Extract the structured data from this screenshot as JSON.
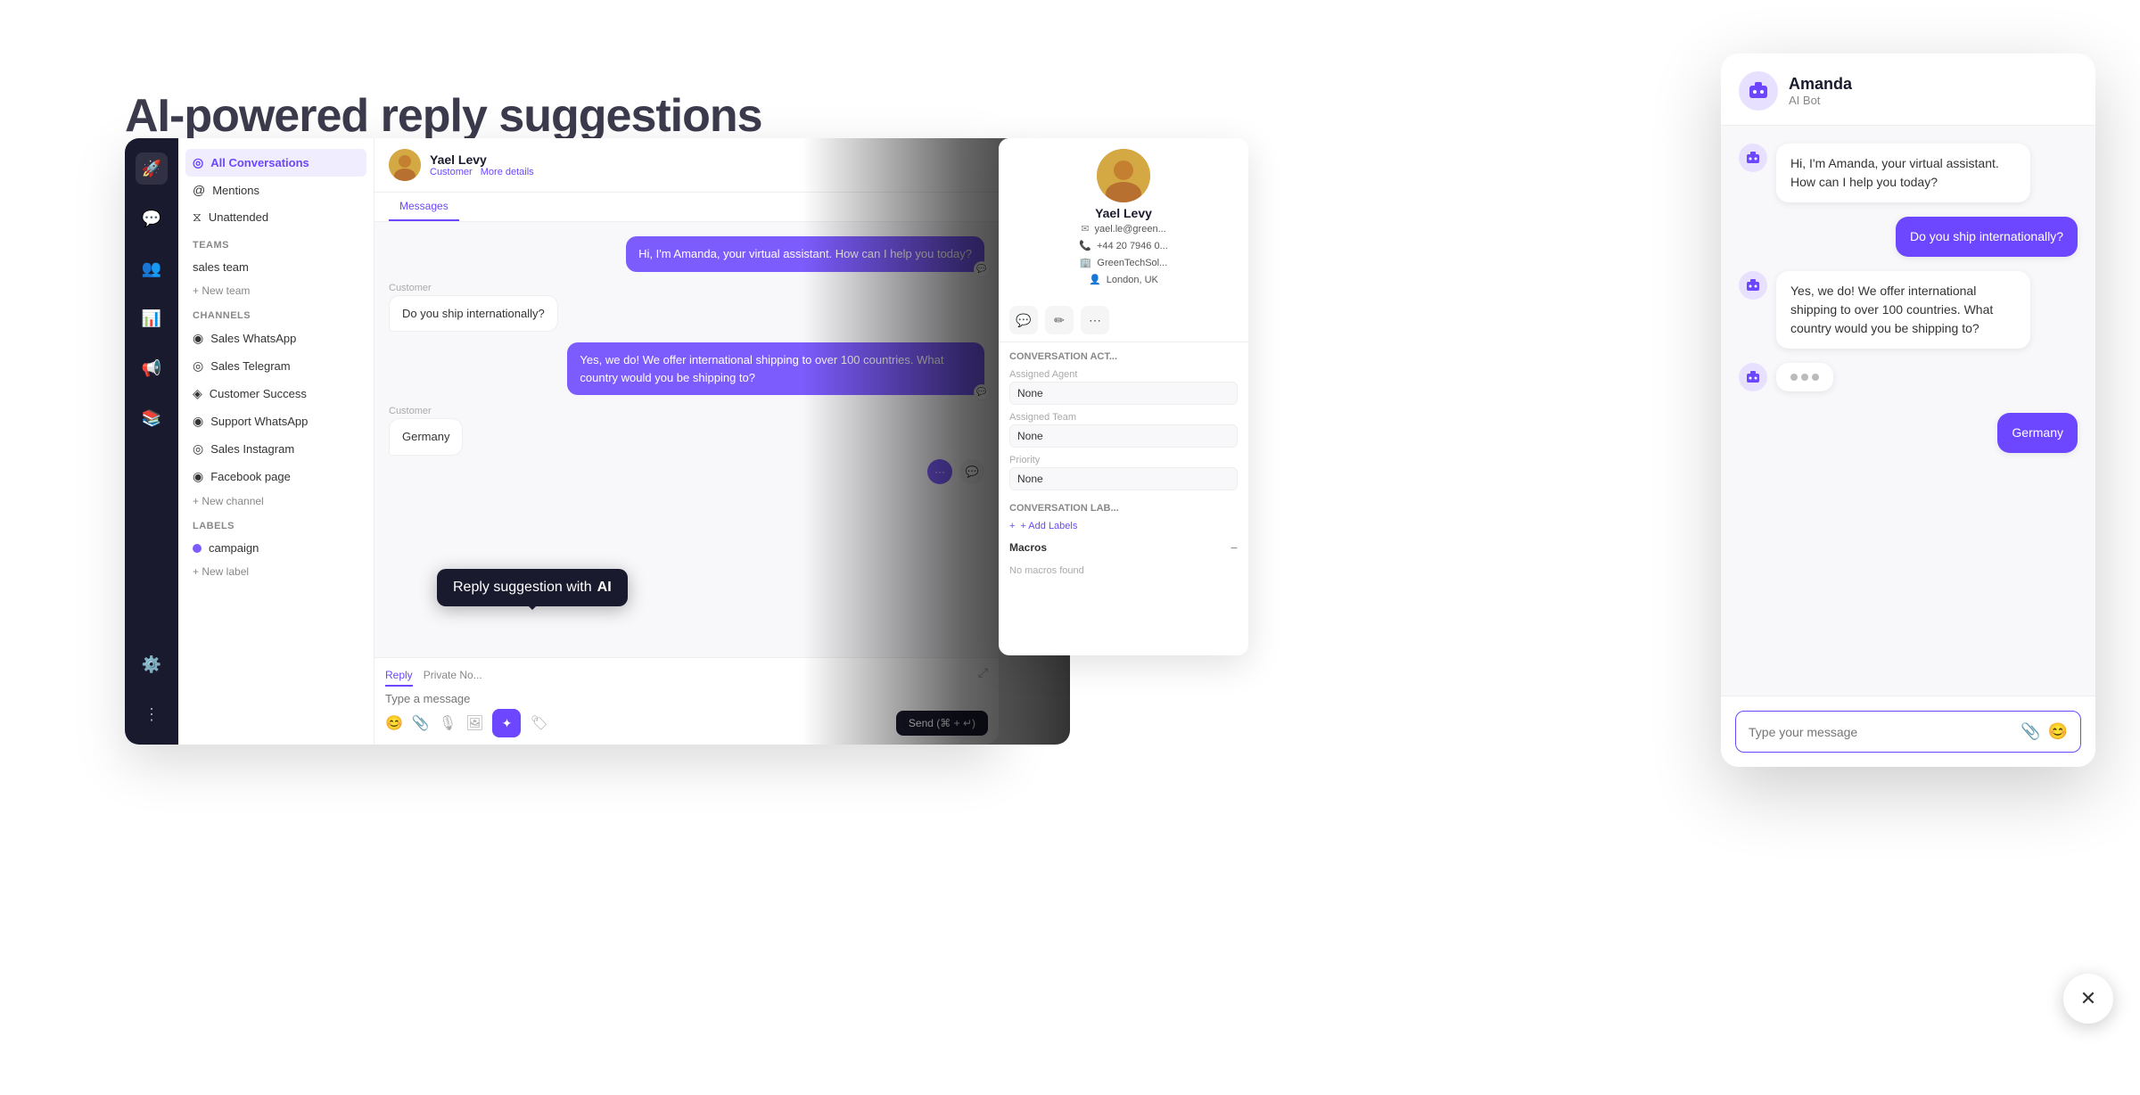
{
  "page": {
    "title": "AI-powered reply suggestions",
    "bg_text": "AI-powered reply suggestions"
  },
  "sidebar": {
    "all_conversations": "All Conversations",
    "mentions": "Mentions",
    "unattended": "Unattended",
    "teams_section": "Teams",
    "sales_team": "sales team",
    "new_team": "+ New team",
    "channels_section": "Channels",
    "channels": [
      "Sales WhatsApp",
      "Sales Telegram",
      "Customer Success",
      "Support WhatsApp",
      "Sales Instagram",
      "Facebook page"
    ],
    "new_channel": "+ New channel",
    "labels_section": "Labels",
    "label_campaign": "campaign",
    "new_label": "+ New label"
  },
  "chat": {
    "customer_name": "Yael Levy",
    "customer_role": "Customer",
    "more_details": "More details",
    "tab_messages": "Messages",
    "messages": [
      {
        "type": "bot",
        "text": "Hi, I'm Amanda, your virtual assistant. How can I help you today?"
      },
      {
        "type": "customer",
        "label": "Customer",
        "text": "Do you ship internationally?"
      },
      {
        "type": "bot",
        "text": "Yes, we do! We offer international shipping to over 100 countries. What country would you be shipping to?"
      },
      {
        "type": "customer",
        "label": "Customer",
        "text": "Germany"
      }
    ],
    "reply_tab_reply": "Reply",
    "reply_tab_private": "Private No...",
    "reply_placeholder": "Type a message",
    "send_button": "Send (⌘ + ↵)"
  },
  "tooltip": {
    "text_before_ai": "Reply suggestion with ",
    "ai_text": "AI"
  },
  "amanda_bot": {
    "name": "Amanda",
    "role": "AI Bot",
    "messages": [
      {
        "type": "bot",
        "text": "Hi, I'm Amanda, your virtual assistant. How can I help you today?"
      },
      {
        "type": "user",
        "text": "Do you ship internationally?"
      },
      {
        "type": "bot",
        "text": "Yes, we do! We offer international shipping to over 100 countries. What country would you be shipping to?"
      },
      {
        "type": "user",
        "text": "Germany"
      }
    ],
    "input_placeholder": "Type your message"
  },
  "customer_panel": {
    "name": "Yael Levy",
    "email": "yael.le@green...",
    "phone": "+44 20 7946 0...",
    "company": "GreenTechSol...",
    "location": "London, UK",
    "conversation_actions": "Conversation Act...",
    "assigned_agent_label": "Assigned Agent",
    "assigned_agent_value": "None",
    "assigned_team_label": "Assigned Team",
    "assigned_team_value": "None",
    "priority_label": "Priority",
    "priority_value": "None",
    "conversation_labels": "Conversation Lab...",
    "add_labels": "+ Add Labels",
    "macros_label": "Macros",
    "no_macros": "No macros found"
  }
}
